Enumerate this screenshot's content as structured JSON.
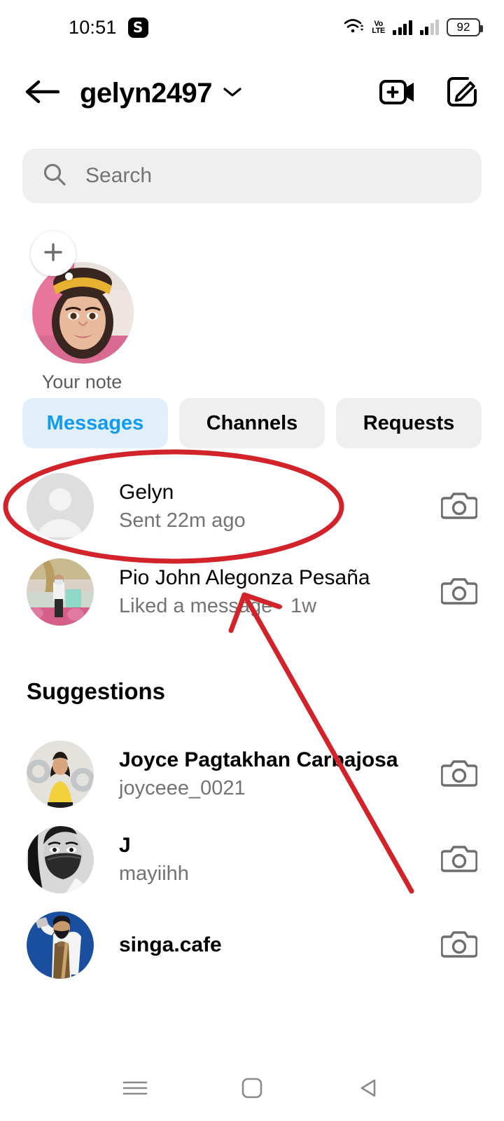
{
  "status_bar": {
    "time": "10:51",
    "app_badge": "S",
    "wifi_icon": "wifi-icon",
    "volte_top": "Vo",
    "volte_bottom": "LTE",
    "signal_icon_1": "signal-bars-icon",
    "signal_icon_2": "signal-bars-icon",
    "battery_level": "92"
  },
  "header": {
    "back_icon": "back-arrow-icon",
    "title": "gelyn2497",
    "chevron_icon": "chevron-down-icon",
    "video_call_icon": "video-call-plus-icon",
    "compose_icon": "compose-edit-icon"
  },
  "search": {
    "icon": "search-icon",
    "placeholder": "Search",
    "value": ""
  },
  "note": {
    "add_icon": "plus-icon",
    "label": "Your note",
    "avatar": "user-photo-avatar"
  },
  "tabs": [
    {
      "label": "Messages",
      "active": true
    },
    {
      "label": "Channels",
      "active": false
    },
    {
      "label": "Requests",
      "active": false
    }
  ],
  "conversations": [
    {
      "name": "Gelyn",
      "preview": "Sent 22m ago",
      "avatar_type": "default-placeholder",
      "camera_icon": "camera-icon"
    },
    {
      "name": "Pio John Alegonza Pesaña",
      "preview": "Liked a message · 1w",
      "avatar_type": "photo-garden",
      "camera_icon": "camera-icon"
    }
  ],
  "suggestions_heading": "Suggestions",
  "suggestions": [
    {
      "name": "Joyce Pagtakhan Carbajosa",
      "username": "joyceee_0021",
      "avatar_type": "photo-yellow-shirt",
      "camera_icon": "camera-icon"
    },
    {
      "name": "J",
      "username": "mayiihh",
      "avatar_type": "photo-bw-mask",
      "camera_icon": "camera-icon"
    },
    {
      "name": "singa.cafe",
      "username": "",
      "avatar_type": "logo-blue-barista",
      "camera_icon": "camera-icon"
    }
  ],
  "nav_bar": {
    "recents_icon": "recents-menu-icon",
    "home_icon": "home-square-icon",
    "back_icon": "back-triangle-icon"
  },
  "annotations": {
    "color": "#d2232a",
    "ellipse_label": "highlight-ellipse-gelyn-row",
    "arrow_label": "pointer-arrow"
  }
}
